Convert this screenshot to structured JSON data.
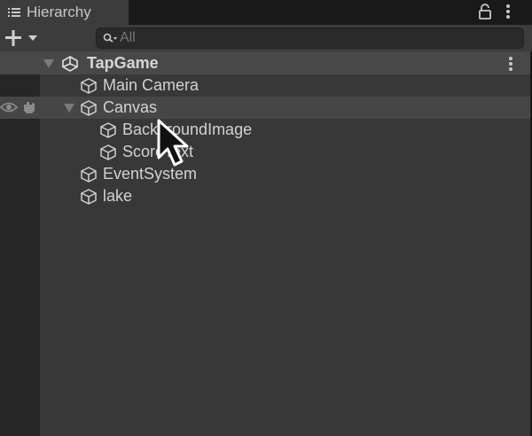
{
  "panel": {
    "tab_title": "Hierarchy"
  },
  "toolbar": {
    "search_placeholder": "All"
  },
  "scene": {
    "name": "TapGame"
  },
  "items": [
    {
      "label": "Main Camera"
    },
    {
      "label": "Canvas"
    },
    {
      "label": "BackgroundImage"
    },
    {
      "label": "ScoreText"
    },
    {
      "label": "EventSystem"
    },
    {
      "label": "lake"
    }
  ],
  "colors": {
    "panel_bg": "#383838",
    "header_bg": "#3c3c3c",
    "scene_row_bg": "#484848",
    "text": "#d2d2d2"
  }
}
